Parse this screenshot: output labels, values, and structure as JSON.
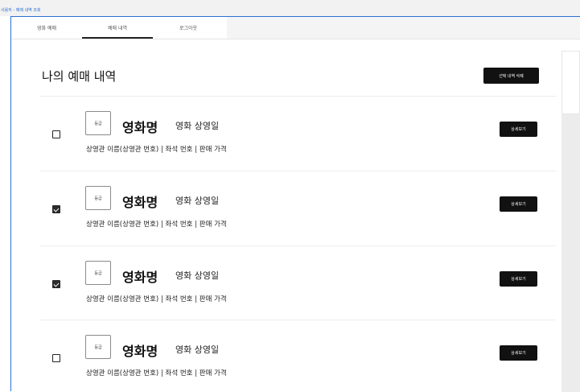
{
  "frame_label": "사용자 - 예매 내역 조회",
  "tabs": [
    {
      "label": "영화 예매",
      "active": false
    },
    {
      "label": "예매 내역",
      "active": true
    },
    {
      "label": "로그아웃",
      "active": false
    }
  ],
  "page": {
    "title": "나의 예매 내역",
    "delete_selected_label": "선택 내역 삭제"
  },
  "reservations": [
    {
      "checked": false,
      "grade": "등급",
      "movie_name": "영화명",
      "screening_date": "영화 상영일",
      "info": "상영관 이름(상영관 번호) | 좌석 번호 | 판매 가격",
      "detail_label": "상세보기"
    },
    {
      "checked": true,
      "grade": "등급",
      "movie_name": "영화명",
      "screening_date": "영화 상영일",
      "info": "상영관 이름(상영관 번호) | 좌석 번호 | 판매 가격",
      "detail_label": "상세보기"
    },
    {
      "checked": true,
      "grade": "등급",
      "movie_name": "영화명",
      "screening_date": "영화 상영일",
      "info": "상영관 이름(상영관 번호) | 좌석 번호 | 판매 가격",
      "detail_label": "상세보기"
    },
    {
      "checked": false,
      "grade": "등급",
      "movie_name": "영화명",
      "screening_date": "영화 상영일",
      "info": "상영관 이름(상영관 번호) | 좌석 번호 | 판매 가격",
      "detail_label": "상세보기"
    }
  ],
  "colors": {
    "accent": "#2b6fd6",
    "button_bg": "#111111",
    "checkbox_checked": "#2d2d2d"
  }
}
